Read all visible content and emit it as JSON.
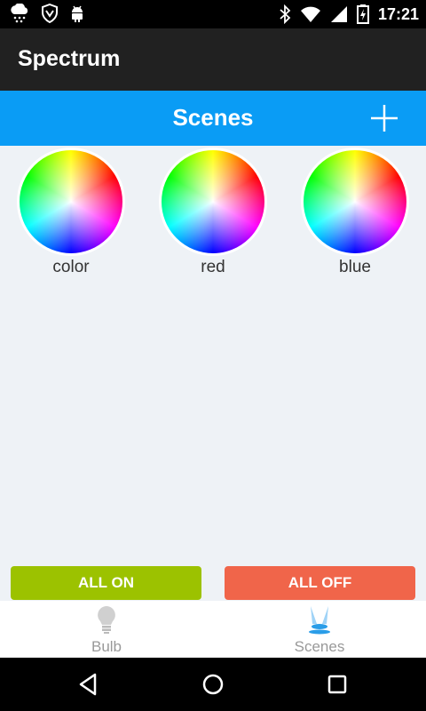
{
  "status_bar": {
    "time": "17:21",
    "left_icons": [
      "cloud-rain-icon",
      "shield-icon",
      "android-icon"
    ],
    "right_icons": [
      "bluetooth-icon",
      "wifi-icon",
      "signal-icon",
      "battery-icon"
    ]
  },
  "app": {
    "title": "Spectrum"
  },
  "header": {
    "title": "Scenes",
    "add_icon": "plus-icon"
  },
  "scenes": [
    {
      "label": "color"
    },
    {
      "label": "red"
    },
    {
      "label": "blue"
    }
  ],
  "buttons": {
    "all_on": "ALL ON",
    "all_off": "ALL OFF"
  },
  "tabs": [
    {
      "label": "Bulb",
      "icon": "bulb-icon"
    },
    {
      "label": "Scenes",
      "icon": "scenes-icon"
    }
  ],
  "nav": [
    "back-icon",
    "home-icon",
    "recents-icon"
  ],
  "colors": {
    "header_blue": "#0a9cf5",
    "all_on_green": "#9cc200",
    "all_off_red": "#f0654a",
    "action_bar": "#212121"
  }
}
